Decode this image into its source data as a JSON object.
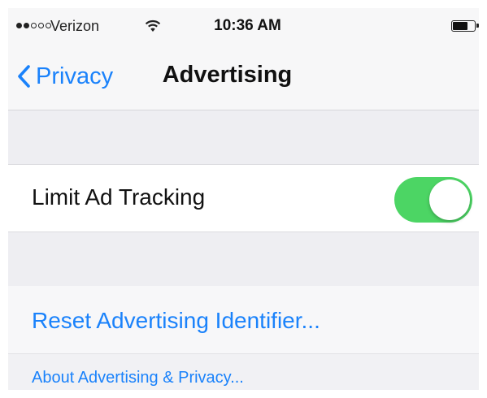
{
  "status_bar": {
    "carrier": "Verizon",
    "time": "10:36 AM",
    "signal_bars_filled": 2,
    "signal_bars_total": 5
  },
  "nav": {
    "back_label": "Privacy",
    "title": "Advertising"
  },
  "settings": {
    "limit_ad_tracking_label": "Limit Ad Tracking",
    "limit_ad_tracking_on": true
  },
  "actions": {
    "reset_label": "Reset Advertising Identifier...",
    "about_label": "About Advertising & Privacy..."
  },
  "colors": {
    "accent": "#1a82fb",
    "toggle_on": "#4cd564"
  }
}
